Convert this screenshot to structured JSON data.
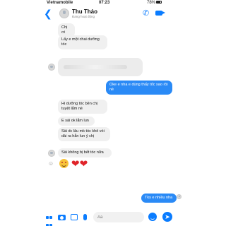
{
  "status_bar": {
    "carrier": "Vietnamobile",
    "time": "07:23",
    "battery": "78%"
  },
  "header": {
    "contact_name": "Thu Thảo",
    "contact_status": "Đang hoạt động",
    "icons": [
      "back-icon",
      "phone-icon",
      "video-call-icon"
    ]
  },
  "messages": [
    {
      "side": "in",
      "text": "Chị ơi"
    },
    {
      "side": "in",
      "text": "Lấy e một chai dưỡng tóc"
    },
    {
      "side": "out",
      "text": "Oke e nha e dùng thấy tốc sao rồi nè"
    },
    {
      "side": "in",
      "text": "Hi dưỡng tóc bên chị tuyệt lắm nè"
    },
    {
      "side": "in",
      "text": "E sài ok lắm lun"
    },
    {
      "side": "in",
      "text": "Sài dc lâu mk tóc khẻ vói dài ra hẳn lun ý chị"
    },
    {
      "side": "in",
      "text": "Sài không bị bết tóc nữa"
    },
    {
      "side": "out",
      "text": "Tks e nhiều nha"
    }
  ],
  "composer": {
    "placeholder": "Aa",
    "icons": [
      "apps-icon",
      "camera-icon",
      "gallery-icon",
      "mic-icon",
      "emoji-icon",
      "send-icon"
    ]
  },
  "colors": {
    "accent": "#0a7cff",
    "outgoing_bubble": "#2a8af6",
    "incoming_bubble": "#f0f0f0",
    "heart": "#e0242a"
  }
}
